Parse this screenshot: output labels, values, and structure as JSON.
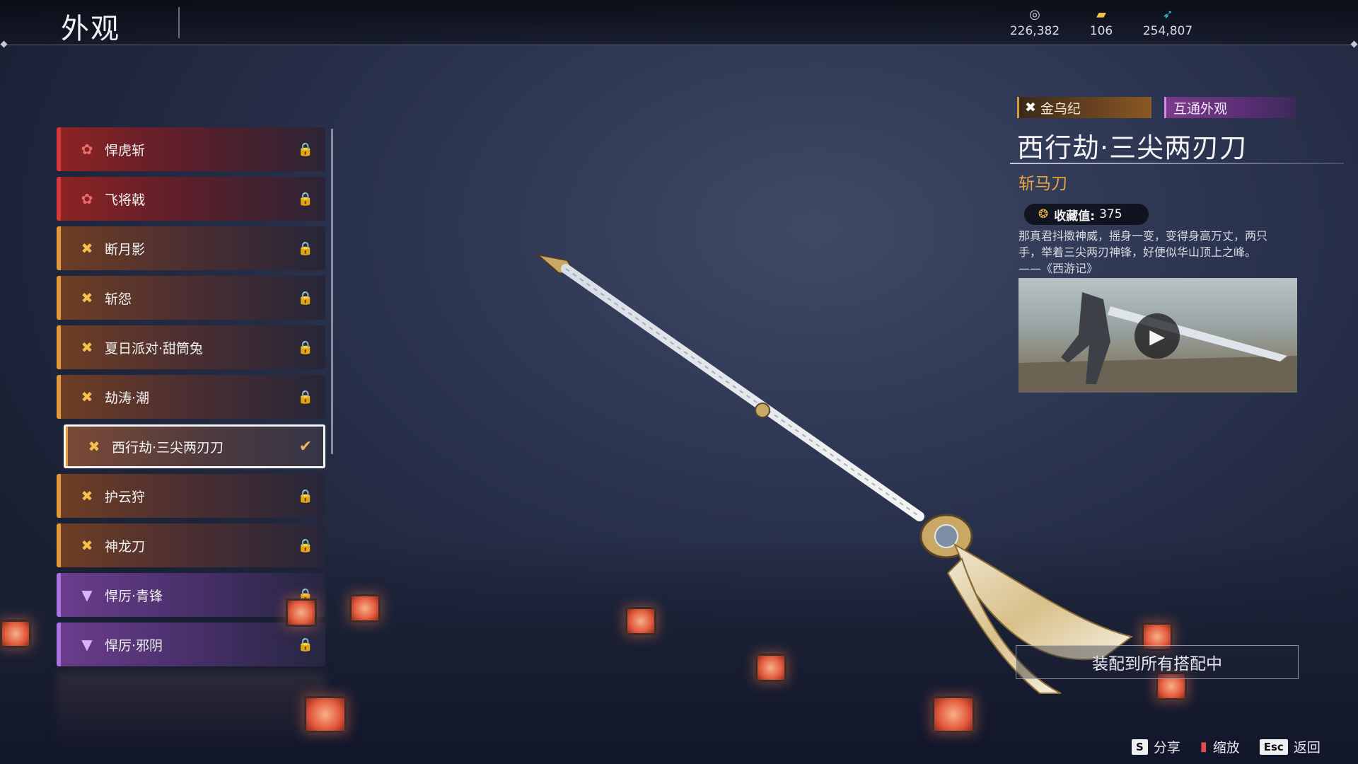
{
  "header": {
    "title": "外观",
    "currencies": [
      {
        "icon": "coin-icon",
        "value": "226,382"
      },
      {
        "icon": "ticket-icon",
        "value": "106"
      },
      {
        "icon": "feather-icon",
        "value": "254,807"
      }
    ]
  },
  "skins": [
    {
      "name": "悍虎斩",
      "rarity": "red",
      "state": "locked"
    },
    {
      "name": "飞将戟",
      "rarity": "red",
      "state": "locked"
    },
    {
      "name": "断月影",
      "rarity": "gold",
      "state": "locked"
    },
    {
      "name": "斩怨",
      "rarity": "gold",
      "state": "locked"
    },
    {
      "name": "夏日派对·甜筒兔",
      "rarity": "gold",
      "state": "locked"
    },
    {
      "name": "劫涛·潮",
      "rarity": "gold",
      "state": "locked"
    },
    {
      "name": "西行劫·三尖两刃刀",
      "rarity": "gold",
      "state": "equipped"
    },
    {
      "name": "护云狩",
      "rarity": "gold",
      "state": "locked"
    },
    {
      "name": "神龙刀",
      "rarity": "gold",
      "state": "locked"
    },
    {
      "name": "悍厉·青锋",
      "rarity": "purple",
      "state": "locked"
    },
    {
      "name": "悍厉·邪阴",
      "rarity": "purple",
      "state": "locked"
    }
  ],
  "detail": {
    "series_tag": "金乌纪",
    "shared_tag": "互通外观",
    "title": "西行劫·三尖两刃刀",
    "weapon_type": "斩马刀",
    "collect_label": "收藏值:",
    "collect_value": "375",
    "desc_lines": [
      "那真君抖擞神威，摇身一变，变得身高万丈，两只",
      "手，举着三尖两刃神锋，好便似华山顶上之峰。",
      "——《西游记》"
    ],
    "equip_button": "装配到所有搭配中"
  },
  "footer": {
    "share_key": "S",
    "share_label": "分享",
    "zoom_label": "缩放",
    "back_key": "Esc",
    "back_label": "返回"
  },
  "colors": {
    "accent_gold": "#e8a441",
    "rarity_red": "#d7383a",
    "rarity_gold": "#e39c3c",
    "rarity_purple": "#a873e0"
  }
}
